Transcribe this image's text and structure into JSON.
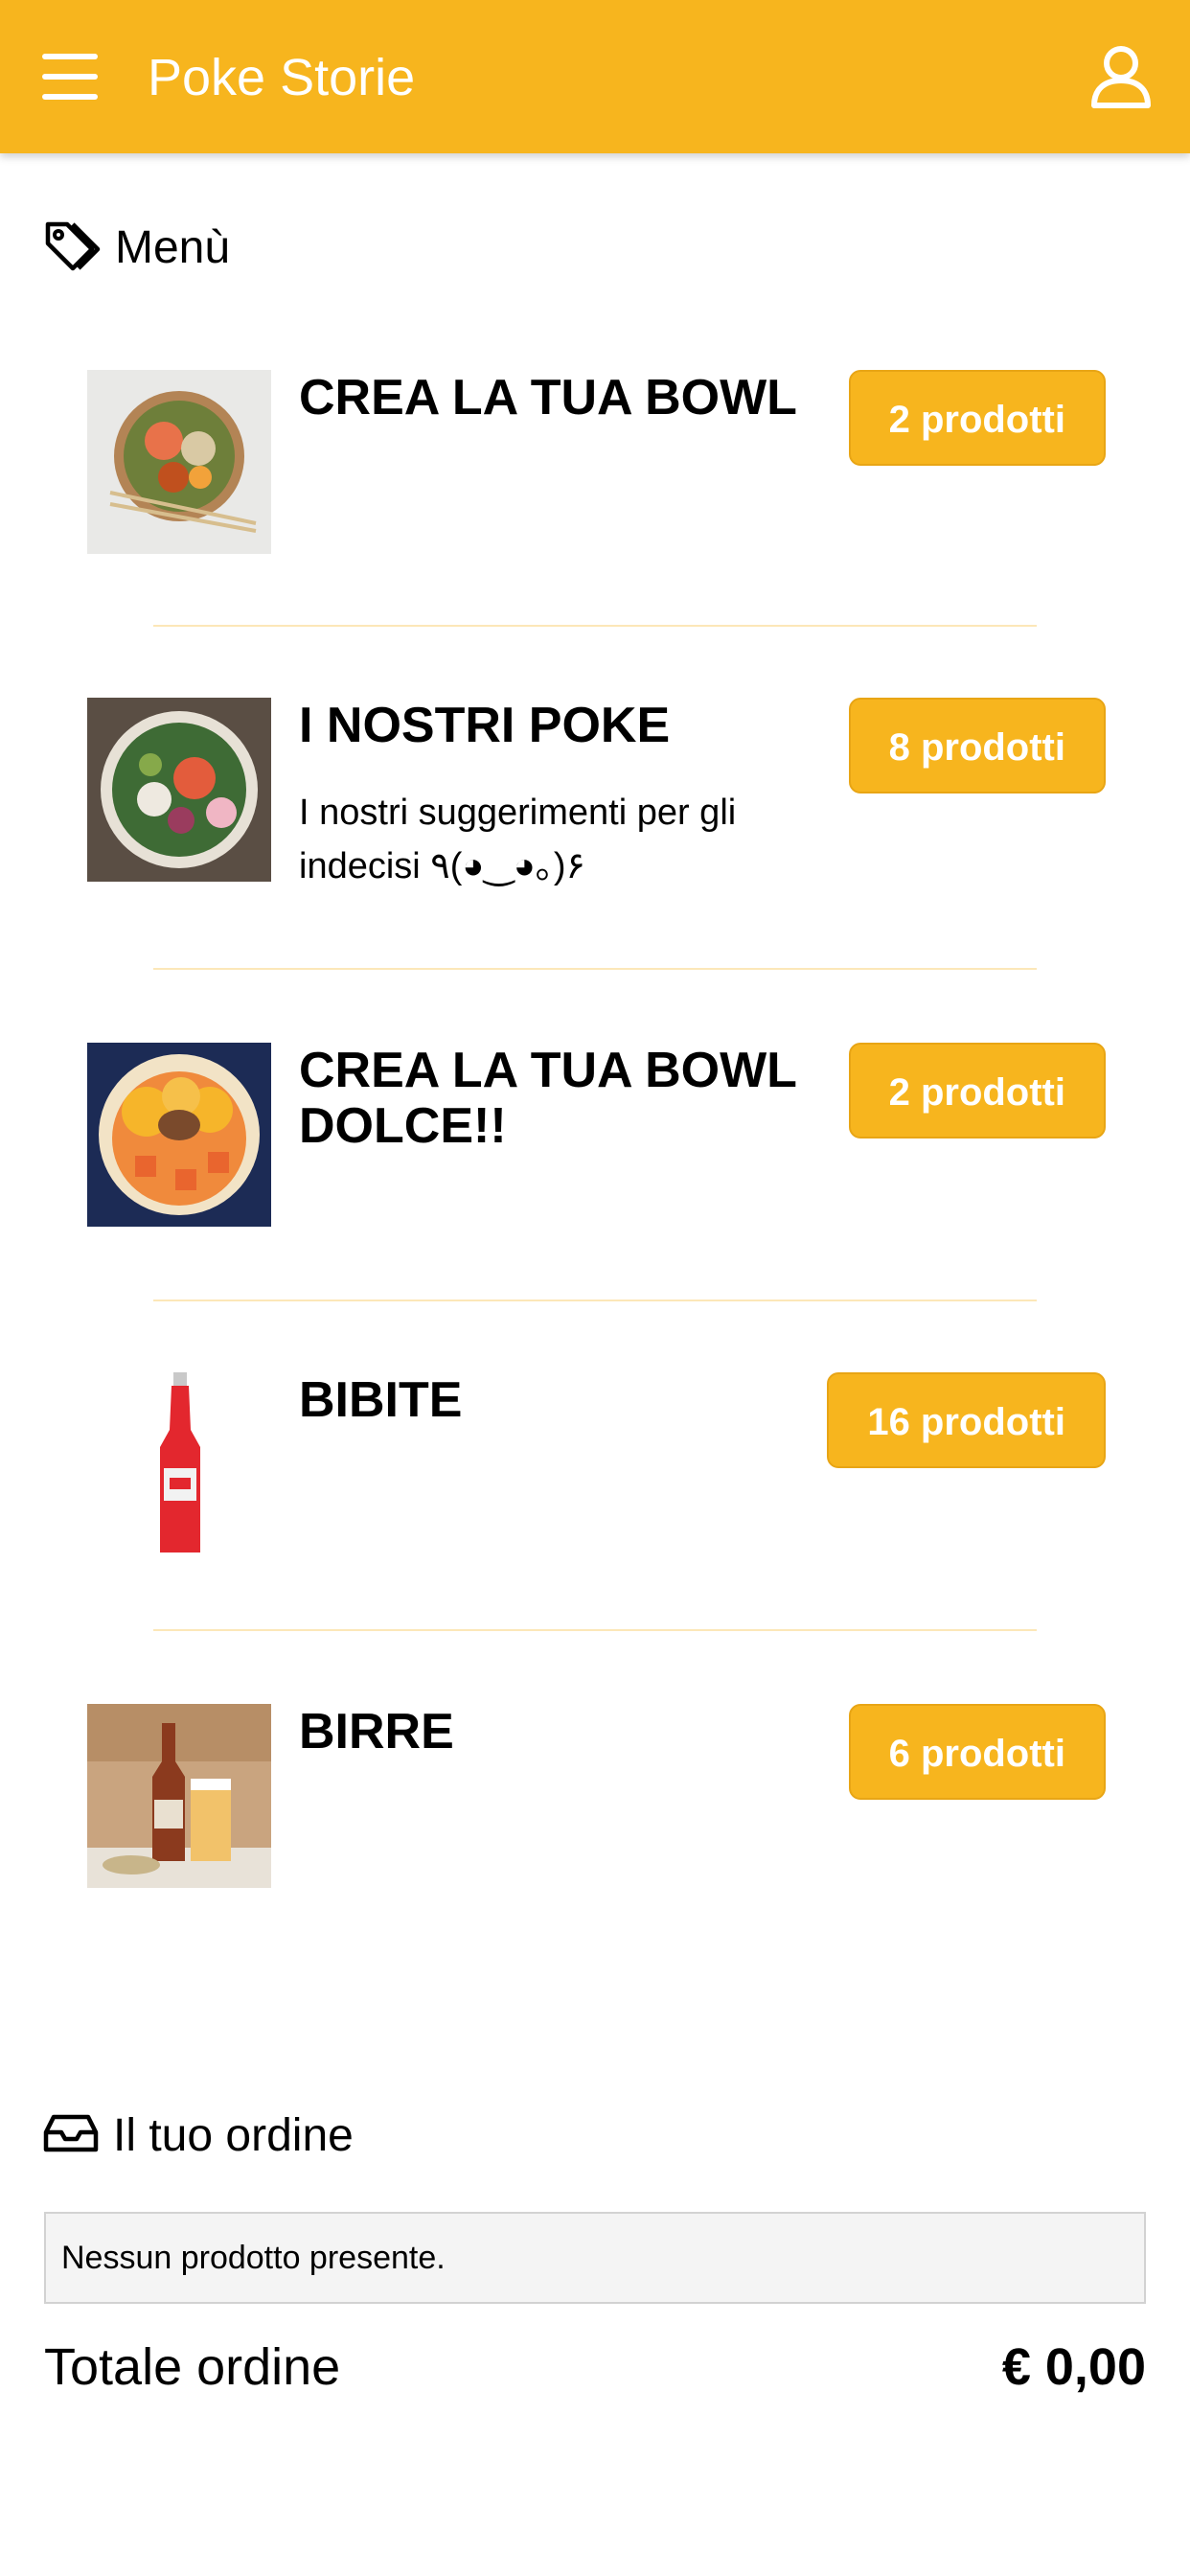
{
  "header": {
    "title": "Poke Storie",
    "menu_icon": "hamburger-menu-icon",
    "profile_icon": "user-profile-icon"
  },
  "menu_section": {
    "title": "Menù",
    "icon": "tags-icon"
  },
  "categories": [
    {
      "name": "CREA LA TUA BOWL",
      "description": "",
      "count_label": "2 prodotti",
      "image": "poke-bowl-photo"
    },
    {
      "name": "I NOSTRI POKE",
      "description": "I nostri suggerimenti per gli indecisi ٩(◕‿◕｡)۶",
      "count_label": "8 prodotti",
      "image": "poke-bowl-photo"
    },
    {
      "name": "CREA LA TUA BOWL DOLCE!!",
      "description": "",
      "count_label": "2 prodotti",
      "image": "fruit-bowl-photo"
    },
    {
      "name": "BIBITE",
      "description": "",
      "count_label": "16 prodotti",
      "image": "soda-bottle-photo"
    },
    {
      "name": "BIRRE",
      "description": "",
      "count_label": "6 prodotti",
      "image": "beer-bottle-photo"
    }
  ],
  "order_section": {
    "title": "Il tuo ordine",
    "icon": "inbox-tray-icon",
    "empty_message": "Nessun prodotto presente.",
    "total_label": "Totale ordine",
    "total_value": "€ 0,00"
  },
  "colors": {
    "brand": "#F7B51E",
    "divider": "#FCE7B8",
    "empty_box_bg": "#F4F4F4"
  }
}
